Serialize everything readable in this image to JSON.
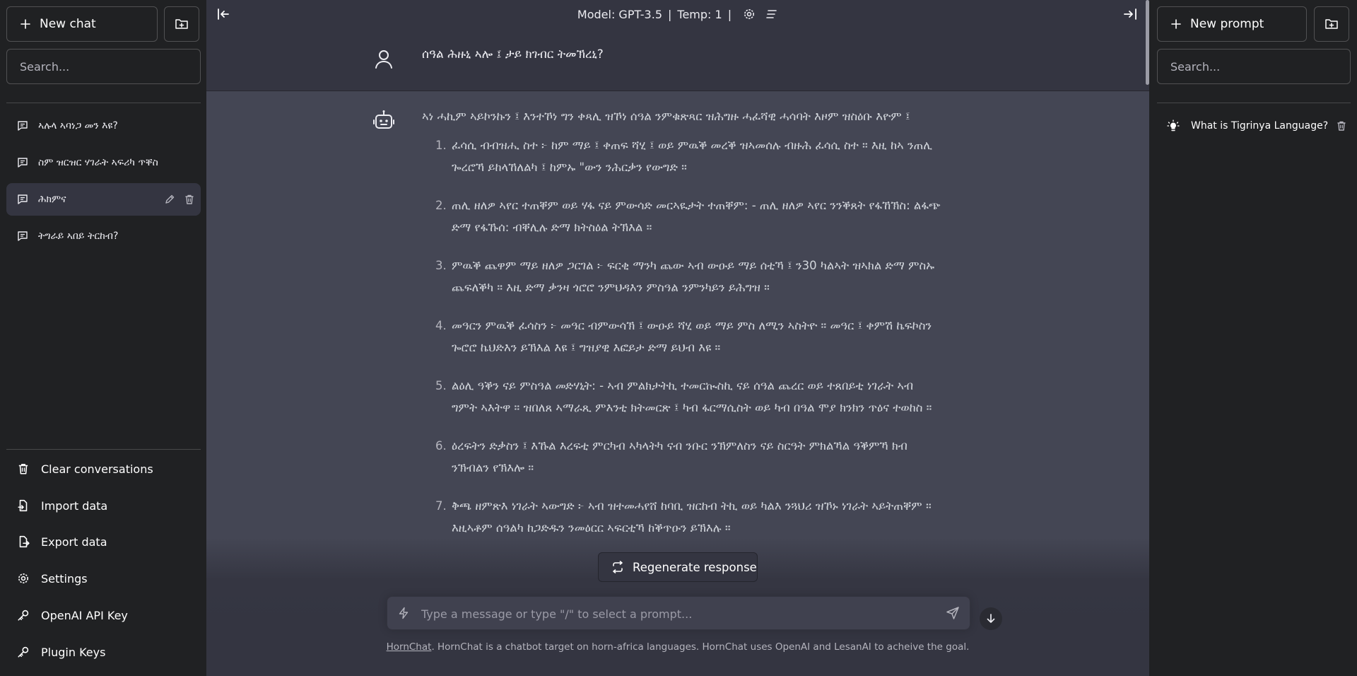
{
  "left_sidebar": {
    "new_chat_label": "New chat",
    "search_placeholder": "Search...",
    "conversations": [
      {
        "label": "ኣሉላ ኣባነጋ መን እዩ?"
      },
      {
        "label": "ስም ዝርዝር ሃገራት ኣፍሪካ ጥቐስ"
      },
      {
        "label": "ሕክምና"
      },
      {
        "label": "ትግራይ ኣበይ ትርከብ?"
      }
    ],
    "bottom_items": [
      {
        "label": "Clear conversations",
        "icon": "trash-icon"
      },
      {
        "label": "Import data",
        "icon": "file-import-icon"
      },
      {
        "label": "Export data",
        "icon": "file-export-icon"
      },
      {
        "label": "Settings",
        "icon": "gear-icon"
      },
      {
        "label": "OpenAI API Key",
        "icon": "key-icon"
      },
      {
        "label": "Plugin Keys",
        "icon": "key-icon"
      }
    ]
  },
  "topbar": {
    "model_label": "Model: GPT-3.5",
    "temp_label": "Temp: 1"
  },
  "chat": {
    "user_message": "ሰዓል ሕዙኒ ኣሎ ፤ ታይ ክገብር ትመኽረኒ?",
    "bot_intro": "ኣነ ሓኪም ኣይኮንኩን ፤ እንተኾነ ግን ቀጻሊ ዝኾነ ሰዓል ንምቁጽጻር ዝሕግዙ ሓፈሻዊ ሓሳባት እዞም ዝስዕቡ እዮም ፤",
    "bot_items": [
      "ፈሳሲ ብብዝሒ ስተ ፦ ከም ማይ ፤ ቀጠፍ ሻሂ ፤ ወይ ምዉቕ መረቕ ዝኣመሰሉ ብዙሕ ፈሳሲ ስተ ። እዚ ከኣ ንጠሊ ጐረሮኻ ይከላኸለልካ ፤ ከምኡ \"ውን ንሕርቃን የውግድ ።",
      "ጠሊ ዘለዎ ኣየር ተጠቐም ወይ ሃፋ ናይ ምውሳድ መርኣዪታት ተጠቐም: - ጠሊ ዘለዎ ኣየር ንንቕጸት የፋኸኽስ: ልፋጭ ድማ የፋኹሰ: ብቐሊሉ ድማ ክትስዕል ትኽእል ።",
      "ምዉቕ ጨዋም ማይ ዘለዎ ጋርገል ፦ ፍርቂ ማንካ ጨው ኣብ ውዑይ ማይ ሰቲኻ ፤ ን30 ካልኣት ዝኣክል ድማ ምስኡ ጨፍለቕካ ። እዚ ድማ ቃንዛ ጎሮሮ ንምህዳእን ምስዓል ንምንካይን ይሕግዝ ።",
      "መዓርን ምዉቕ ፈሳስን ፦ መዓር ብምውሳኽ ፤ ውዑይ ሻሂ ወይ ማይ ምስ ለሚን ኣስትዮ ። መዓር ፤ ቀምሽ ኬፍኮስን ጐሮሮ ኬህድእን ይኽእል እዩ ፤ ግዝያዊ እፎይታ ድማ ይህብ እዩ ።",
      "ልዕሊ ዓቕን ናይ ምስዓል መድሃኒት: - ኣብ ምልክታትኪ ተመርኲስኪ ናይ ሰዓል ጨረር ወይ ተጸበይቲ ነገራት ኣብ ግምት ኣእትዋ ። ዝበለጸ ኣማራጺ ምእንቲ ክትመርጽ ፤ ካብ ፋርማሲስት ወይ ካብ በዓል ሞያ ክንክን ጥዕና ተወከስ ።",
      "ዕረፍትን ድቃስን ፤ እኹል እረፍቲ ምርካብ ኣካላትካ ናብ ንቡር ንኽምለስን ናይ ስርዓት ምክልኻል ዓቕምኻ ክብ ንኽብልን የኽእሎ ።",
      "ቅጫ ዘምጽእ ነገራት ኣውግድ ፦ ኣብ ዝተመሓየሸ ከባቢ ዝርከብ ትኪ ወይ ካልእ ንጓህሪ ዝኾኑ ነገራት ኣይትጠቐም ። እዚኣቶም ሰዓልካ ከጋድዱን ንመዕርር ኣፍርቲኻ ከቕጥዑን ይኽእሉ ።"
    ],
    "regenerate_label": "Regenerate response",
    "input_placeholder": "Type a message or type \"/\" to select a prompt...",
    "footer_link": "HornChat",
    "footer_text": ". HornChat is a chatbot target on horn-africa languages. HornChat uses OpenAI and LesanAI to acheive the goal."
  },
  "right_sidebar": {
    "new_prompt_label": "New prompt",
    "search_placeholder": "Search...",
    "prompts": [
      {
        "label": "What is Tigrinya Language?"
      }
    ]
  }
}
